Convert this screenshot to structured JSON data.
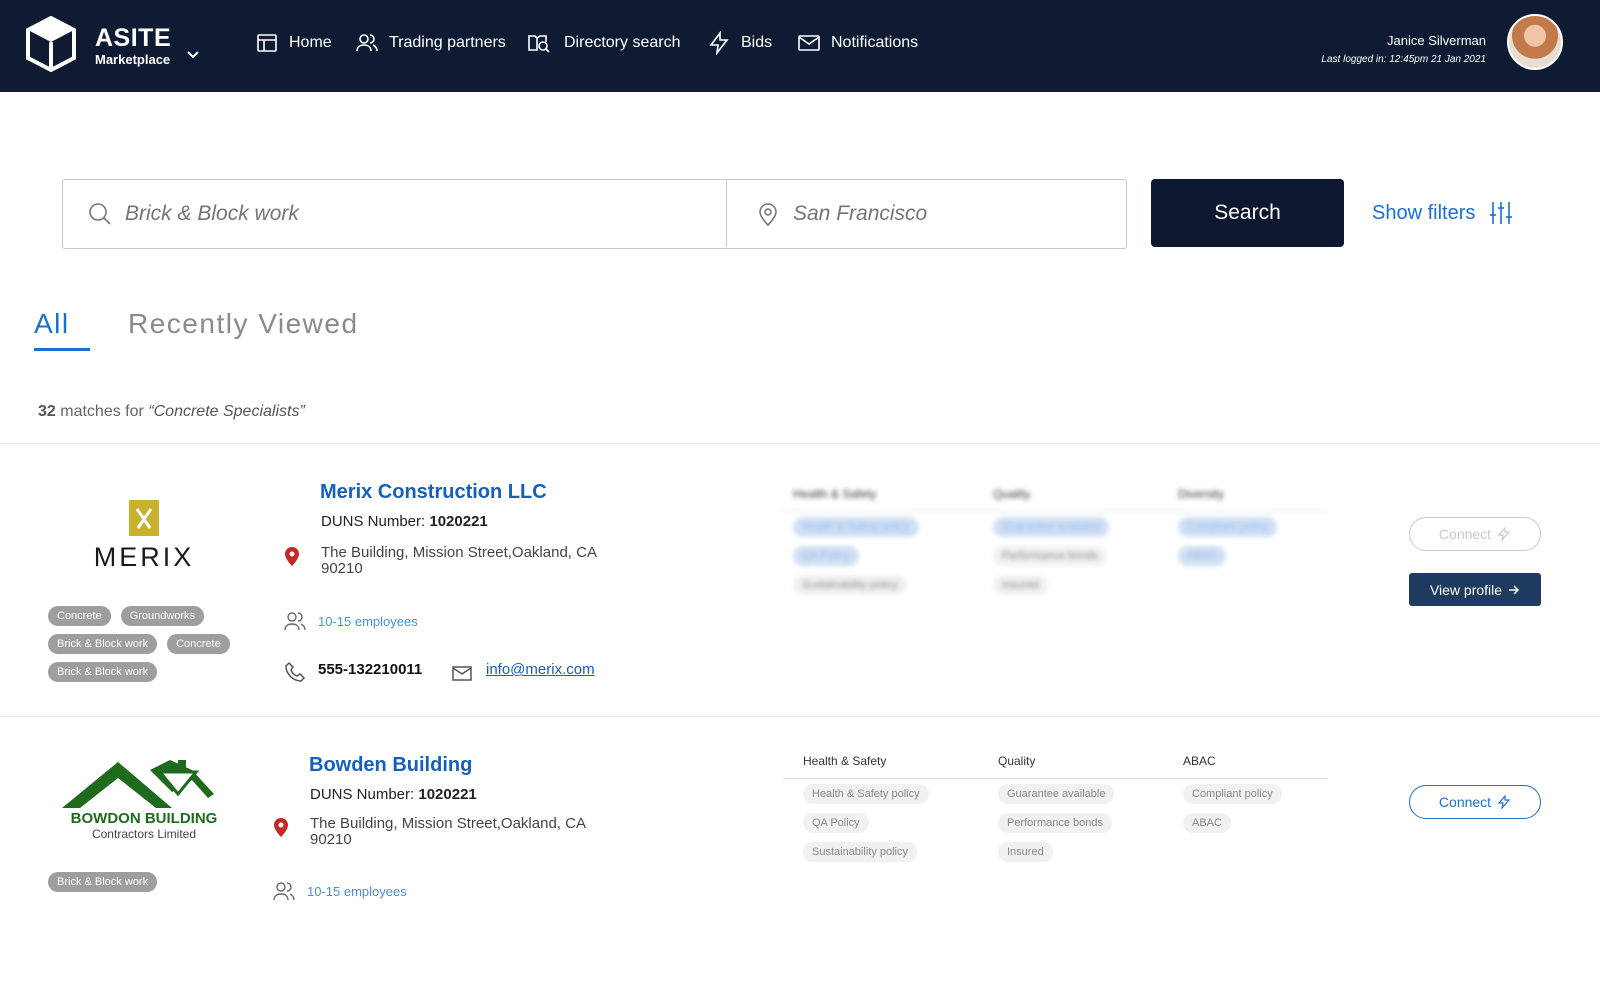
{
  "brand": {
    "name": "ASITE",
    "sub": "Marketplace"
  },
  "nav": [
    {
      "label": "Home",
      "icon": "home-icon"
    },
    {
      "label": "Trading partners",
      "icon": "users-icon"
    },
    {
      "label": "Directory search",
      "icon": "directory-search-icon"
    },
    {
      "label": "Bids",
      "icon": "lightning-icon"
    },
    {
      "label": "Notifications",
      "icon": "mail-icon"
    }
  ],
  "user": {
    "name": "Janice Silverman",
    "last_logged": "Last logged in: 12:45pm 21 Jan 2021"
  },
  "search": {
    "keyword_placeholder": "Brick & Block work",
    "location_placeholder": "San Francisco",
    "button_label": "Search",
    "filters_label": "Show filters"
  },
  "tabs": {
    "all": "All",
    "recent": "Recently Viewed"
  },
  "results": {
    "count": "32",
    "matches_text": " matches for ",
    "query": "“Concrete Specialists”"
  },
  "companies": [
    {
      "name": "Merix Construction LLC",
      "logo_text": "MERIX",
      "duns_label": "DUNS Number:",
      "duns": "1020221",
      "address": "The Building, Mission Street,Oakland, CA 90210",
      "employees": "10-15 employees",
      "phone": "555-132210011",
      "email": "info@merix.com",
      "tags": [
        "Concrete",
        "Groundworks",
        "Brick & Block work",
        "Concrete",
        "Brick & Block work"
      ],
      "compliance": {
        "headers": [
          "Health & Safety",
          "Quality",
          "Diversity"
        ],
        "col1": [
          "Health & Safety policy",
          "QA Policy",
          "Sustainability policy"
        ],
        "col2": [
          "Guarantee available",
          "Performance bonds",
          "Insured"
        ],
        "col3": [
          "Compliant policy",
          "ABAC"
        ]
      },
      "connect_label": "Connect",
      "view_label": "View profile"
    },
    {
      "name": "Bowden Building",
      "logo_text": "BOWDON BUILDING",
      "logo_sub": "Contractors Limited",
      "duns_label": "DUNS Number:",
      "duns": "1020221",
      "address": "The Building, Mission Street,Oakland, CA 90210",
      "employees": "10-15 employees",
      "tags": [
        "Brick & Block work"
      ],
      "compliance": {
        "headers": [
          "Health & Safety",
          "Quality",
          "ABAC"
        ],
        "col1": [
          "Health & Safety policy",
          "QA Policy",
          "Sustainability policy"
        ],
        "col2": [
          "Guarantee available",
          "Performance bonds",
          "Insured"
        ],
        "col3": [
          "Compliant policy",
          "ABAC"
        ]
      },
      "connect_label": "Connect"
    }
  ],
  "colors": {
    "navbar": "#0f1b33",
    "accent": "#1a6fd1",
    "primary_button": "#0b1830",
    "view_button": "#1f3a5f",
    "merix_gold": "#c8b12c",
    "bowdon_green": "#1e6b1e"
  }
}
